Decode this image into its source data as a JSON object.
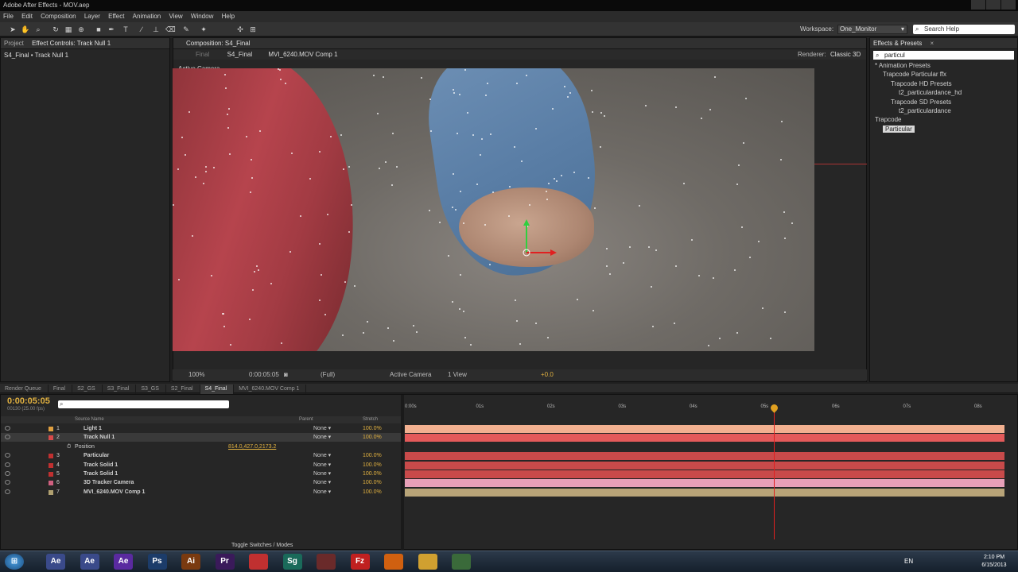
{
  "window": {
    "title": "Adobe After Effects - MOV.aep"
  },
  "menu": [
    "File",
    "Edit",
    "Composition",
    "Layer",
    "Effect",
    "Animation",
    "View",
    "Window",
    "Help"
  ],
  "toolbar": {
    "workspace_label": "Workspace:",
    "workspace_value": "One_Monitor",
    "search_placeholder": "Search Help"
  },
  "left_panel": {
    "tabs": [
      "Project",
      "Effect Controls: Track Null 1"
    ],
    "breadcrumb": "S4_Final • Track Null 1"
  },
  "comp_panel": {
    "tab": "Composition: S4_Final",
    "sub_final": "Final",
    "sub_tabs": [
      "S4_Final",
      "MVI_6240.MOV Comp 1"
    ],
    "renderer_label": "Renderer:",
    "renderer_value": "Classic 3D",
    "view_label": "Active Camera",
    "footer": {
      "zoom": "100%",
      "timecode": "0:00:05:05",
      "resolution": "(Full)",
      "camera": "Active Camera",
      "views": "1 View",
      "exposure": "+0.0"
    }
  },
  "effects_panel": {
    "tab": "Effects & Presets",
    "search_value": "particul",
    "tree": [
      {
        "label": "* Animation Presets",
        "level": 0
      },
      {
        "label": "Trapcode Particular ffx",
        "level": 1
      },
      {
        "label": "Trapcode HD Presets",
        "level": 2
      },
      {
        "label": "t2_particulardance_hd",
        "level": 3
      },
      {
        "label": "Trapcode SD Presets",
        "level": 2
      },
      {
        "label": "t2_particulardance",
        "level": 3
      },
      {
        "label": "Trapcode",
        "level": 0
      },
      {
        "label": "Particular",
        "level": 1,
        "selected": true
      }
    ]
  },
  "timeline": {
    "tabs": [
      "Render Queue",
      "Final",
      "S2_GS",
      "S3_Final",
      "S3_GS",
      "S2_Final",
      "S4_Final",
      "MVI_6240.MOV Comp 1"
    ],
    "active_tab": "S4_Final",
    "timecode": "0:00:05:05",
    "timecode_sub": "00130 (25.00 fps)",
    "search_placeholder": "",
    "headers": {
      "source": "Source Name",
      "parent": "Parent",
      "stretch": "Stretch"
    },
    "layers": [
      {
        "num": "1",
        "name": "Light 1",
        "parent": "None",
        "stretch": "100.0%",
        "color": "#e0a040",
        "bar": "#f2b090"
      },
      {
        "num": "2",
        "name": "Track Null 1",
        "parent": "None",
        "stretch": "100.0%",
        "color": "#d84a4a",
        "bar": "#e45a5a",
        "selected": true
      },
      {
        "num": "3",
        "name": "Particular",
        "parent": "None",
        "stretch": "100.0%",
        "color": "#c03030",
        "bar": "#c84a4a"
      },
      {
        "num": "4",
        "name": "Track Solid 1",
        "parent": "None",
        "stretch": "100.0%",
        "color": "#c03030",
        "bar": "#c84a4a"
      },
      {
        "num": "5",
        "name": "Track Solid 1",
        "parent": "None",
        "stretch": "100.0%",
        "color": "#c03030",
        "bar": "#c84a4a"
      },
      {
        "num": "6",
        "name": "3D Tracker Camera",
        "parent": "None",
        "stretch": "100.0%",
        "color": "#d06080",
        "bar": "#e8a0b8"
      },
      {
        "num": "7",
        "name": "MVI_6240.MOV Comp 1",
        "parent": "None",
        "stretch": "100.0%",
        "color": "#b0a070",
        "bar": "#b8a478"
      }
    ],
    "property": {
      "name": "Position",
      "value": "814.0,427.0,2173.2"
    },
    "ruler": [
      "0:00s",
      "01s",
      "02s",
      "03s",
      "04s",
      "05s",
      "06s",
      "07s",
      "08s"
    ],
    "toggle_label": "Toggle Switches / Modes"
  },
  "taskbar": {
    "apps": [
      "Ae",
      "Ae",
      "Ae",
      "Ps",
      "Ai",
      "Pr",
      "Chrome",
      "Sg",
      "App",
      "Fz",
      "Player",
      "Folder",
      "App"
    ],
    "lang": "EN",
    "time": "2:10 PM",
    "date": "6/15/2013"
  }
}
